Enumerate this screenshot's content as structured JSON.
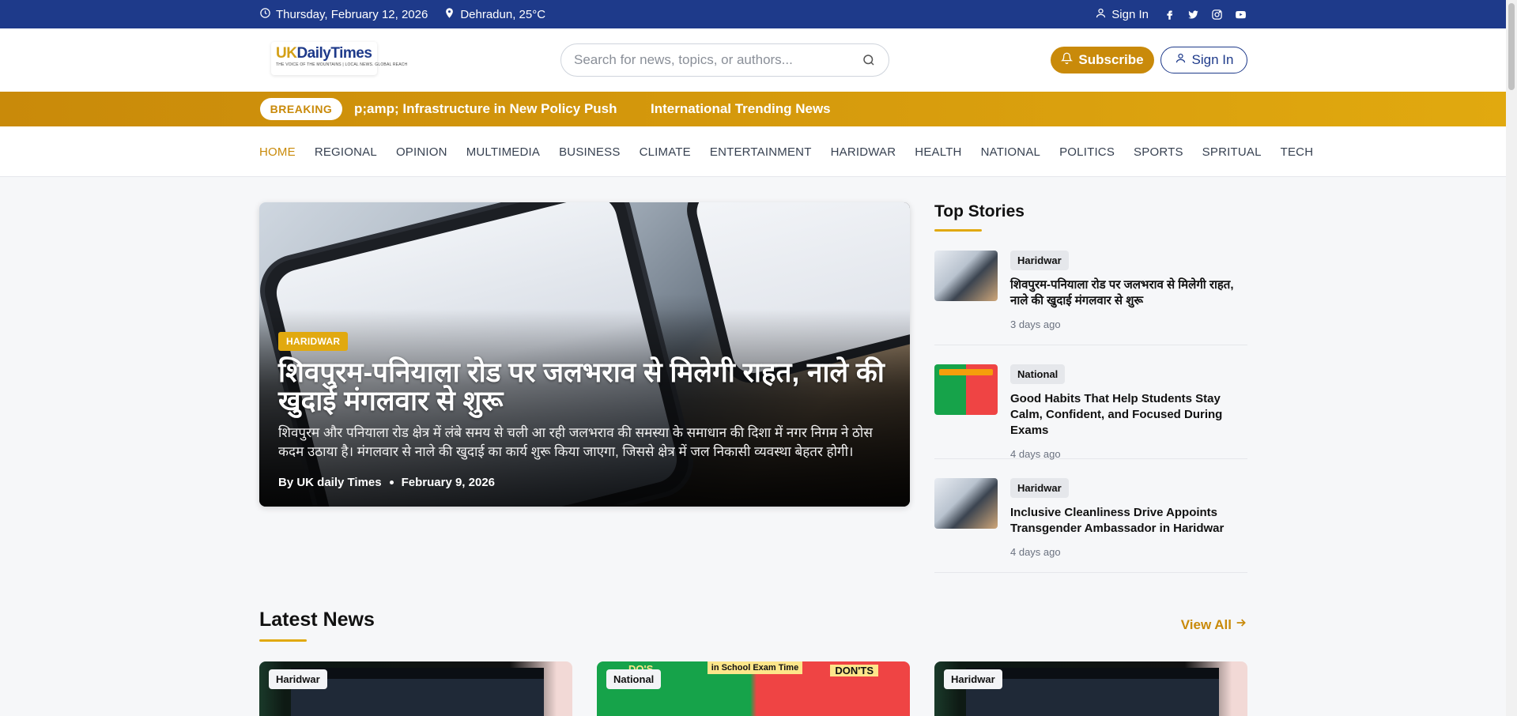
{
  "topbar": {
    "date": "Thursday, February 12, 2026",
    "location": "Dehradun, 25°C",
    "signin": "Sign In",
    "social": [
      "facebook-icon",
      "twitter-icon",
      "instagram-icon",
      "youtube-icon"
    ]
  },
  "header": {
    "logo": {
      "uk": "UK",
      "name": "DailyTimes",
      "tagline": "THE VOICE OF THE MOUNTAINS | LOCAL NEWS. GLOBAL REACH"
    },
    "search_placeholder": "Search for news, topics, or authors...",
    "subscribe_label": "Subscribe",
    "signin_label": "Sign In"
  },
  "breaking": {
    "badge": "BREAKING",
    "items": [
      "p;amp; Infrastructure in New Policy Push",
      "International Trending News"
    ]
  },
  "nav": {
    "items": [
      "HOME",
      "REGIONAL",
      "OPINION",
      "MULTIMEDIA",
      "BUSINESS",
      "CLIMATE",
      "ENTERTAINMENT",
      "HARIDWAR",
      "HEALTH",
      "NATIONAL",
      "POLITICS",
      "SPORTS",
      "SPRITUAL",
      "TECH"
    ],
    "active": "HOME"
  },
  "hero": {
    "category": "HARIDWAR",
    "title": "शिवपुरम-पनियाला रोड पर जलभराव से मिलेगी राहत, नाले की खुदाई मंगलवार से शुरू",
    "excerpt": "शिवपुरम और पनियाला रोड क्षेत्र में लंबे समय से चली आ रही जलभराव की समस्या के समाधान की दिशा में नगर निगम ने ठोस कदम उठाया है। मंगलवार से नाले की खुदाई का कार्य शुरू किया जाएगा, जिससे क्षेत्र में जल निकासी व्यवस्था बेहतर होगी।",
    "author": "By UK daily Times",
    "date": "February 9, 2026"
  },
  "top_stories": {
    "title": "Top Stories",
    "items": [
      {
        "tag": "Haridwar",
        "headline": "शिवपुरम-पनियाला रोड पर जलभराव से मिलेगी राहत, नाले की खुदाई मंगलवार से शुरू",
        "ago": "3 days ago"
      },
      {
        "tag": "National",
        "headline": "Good Habits That Help Students Stay Calm, Confident, and Focused During Exams",
        "ago": "4 days ago"
      },
      {
        "tag": "Haridwar",
        "headline": "Inclusive Cleanliness Drive Appoints Transgender Ambassador in Haridwar",
        "ago": "4 days ago"
      }
    ]
  },
  "latest": {
    "title": "Latest News",
    "view_all": "View All",
    "cards": [
      {
        "tag": "Haridwar"
      },
      {
        "tag": "National",
        "banner": "in School Exam Time",
        "dos": "DO'S",
        "donts": "DON'TS"
      },
      {
        "tag": "Haridwar"
      }
    ]
  }
}
